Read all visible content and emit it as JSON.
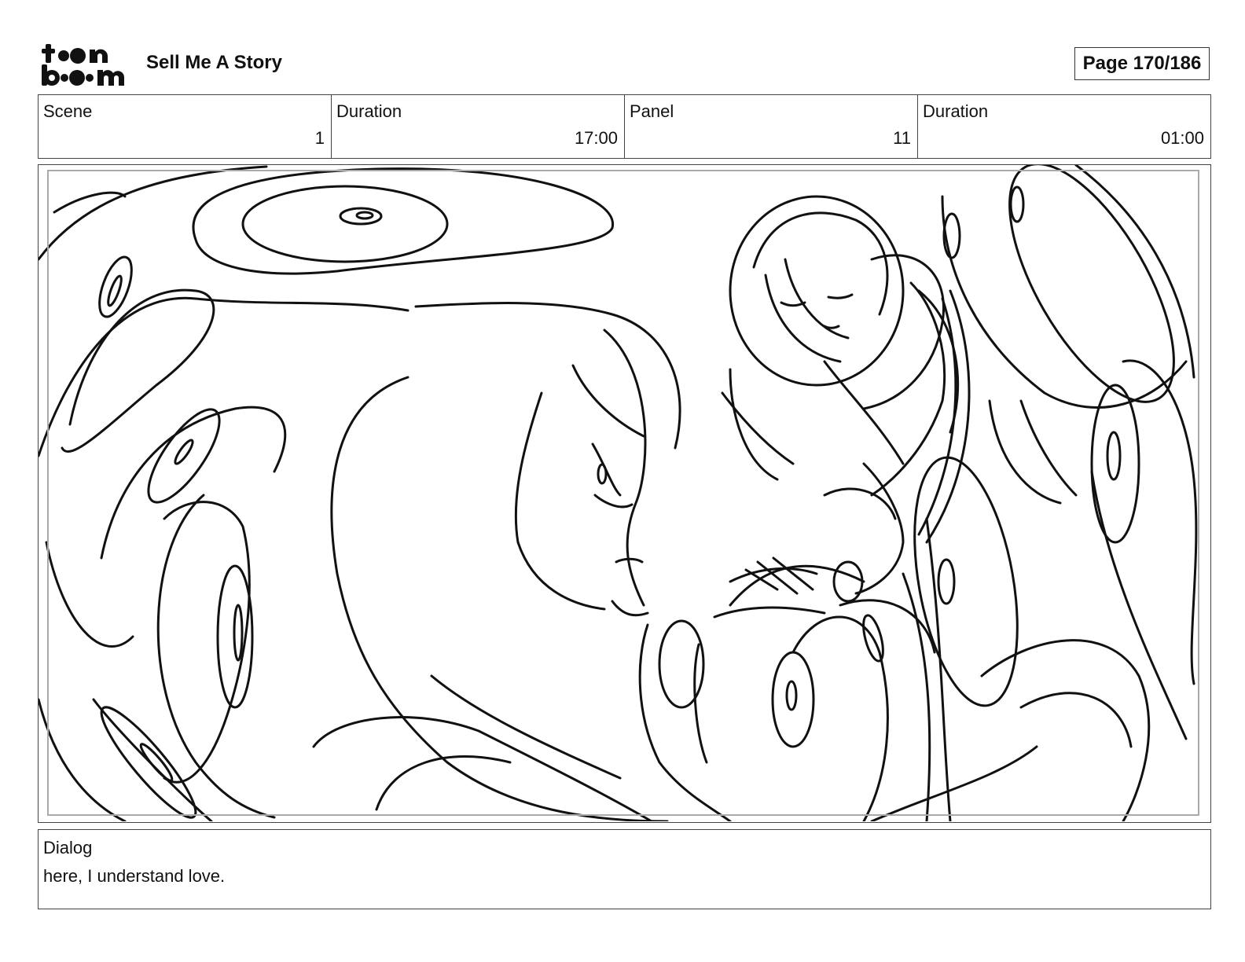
{
  "header": {
    "logo_alt": "toon boom",
    "project_title": "Sell Me A Story",
    "page_label": "Page 170/186"
  },
  "info": {
    "scene_label": "Scene",
    "scene_value": "1",
    "scene_duration_label": "Duration",
    "scene_duration_value": "17:00",
    "panel_label": "Panel",
    "panel_value": "11",
    "panel_duration_label": "Duration",
    "panel_duration_value": "01:00"
  },
  "panel": {
    "image_icon": "storyboard-sketch"
  },
  "dialog": {
    "label": "Dialog",
    "text": "here, I understand love."
  },
  "colors": {
    "ink": "#111111",
    "border": "#444444",
    "inner_border": "#aaaaaa"
  }
}
